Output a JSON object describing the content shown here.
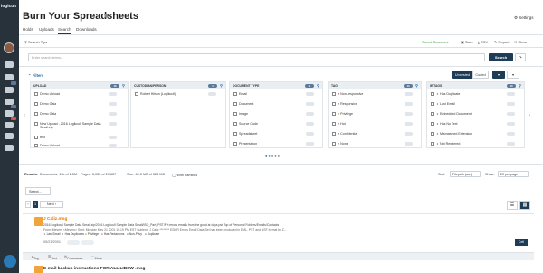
{
  "app": {
    "logo": "logicuit",
    "title": "Burn Your Spreadsheets",
    "settings": "Settings"
  },
  "tabs": [
    "Holds",
    "Uploads",
    "Search",
    "Downloads"
  ],
  "searchbar": {
    "tips": "Search Tips",
    "saved": "Saved Searches",
    "save": "Save",
    "csv": "CSV",
    "report": "Report",
    "clear": "Clear",
    "placeholder": "Enter search terms...",
    "search_btn": "Search"
  },
  "filters": {
    "label": "Filters",
    "unnested": "Unnested",
    "coded": "Coded"
  },
  "panels": {
    "upload": {
      "title": "UPLOAD",
      "count": "16",
      "items": [
        "Demo Upload",
        "Demo Gala",
        "Demo Gala",
        "New Upload - 2016 Logikcull Sample Data Small.zip",
        "test",
        "Demo Upload"
      ]
    },
    "custodian": {
      "title": "CUSTODIAN/PERSON",
      "count": "1",
      "items": [
        "Robert Hilson (Logikcull)"
      ]
    },
    "doctype": {
      "title": "DOCUMENT TYPE",
      "count": "11",
      "items": [
        "Email",
        "Document",
        "Image",
        "Source Code",
        "Spreadsheet",
        "Presentation"
      ]
    },
    "tag": {
      "title": "TAG",
      "count": "13",
      "items": [
        "Non-responsive",
        "Responsive",
        "Privilege",
        "Hot",
        "Confidential",
        "None"
      ]
    },
    "ietags": {
      "title": "IE TAGS",
      "count": "10",
      "items": [
        "Has Duplicate",
        "Last Email",
        "Embedded Document",
        "Has No Text",
        "Mismatched Extension",
        "Not Rendered"
      ]
    }
  },
  "results": {
    "label": "Results:",
    "docs": "Documents: 19k of 2.5M",
    "pages": "Pages: 3,055 of 29,657",
    "size": "Size: 60.5 MB of 524 MB",
    "families": "With Families",
    "sort_label": "Sort:",
    "sort_val": "Filepath (a-z)",
    "show_label": "Show:",
    "show_val": "20 per page"
  },
  "select": "Select...",
  "pager": {
    "page": "1",
    "next": "Next"
  },
  "doc": {
    "title": "J Caliz.msg",
    "line1": "2016 Logikcull Sample Data Small.zip/2016 Logikcull Sample Data Small/ISO_Part_PST/Fyi errors emails from the good at days.pst Top of Personal Folders/Emails/Contacts",
    "line2": "From: Meyers <Meyers> Sent: Monday May 21 2001 10:19 PM EST Subject:: J Caliz",
    "line3": "******** ESMR Errors Email Data Set has been produced in EML, PST and NSF format by Z...",
    "chips": [
      "Last Email",
      "Has Duplicates",
      "Privilege",
      "Has Redactions",
      "Non-Privy",
      "Duplicate"
    ],
    "date": "05/21/2001",
    "actions": [
      "Tag",
      "Text",
      "Comments",
      "More"
    ],
    "cell_btn": "Cell"
  },
  "doc2": {
    "title": "E-mail backup instructions FOR ALL LIBSW .msg"
  }
}
